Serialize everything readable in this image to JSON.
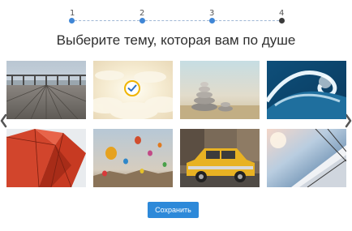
{
  "stepper": {
    "steps": [
      {
        "label": "1",
        "state": "done"
      },
      {
        "label": "2",
        "state": "done"
      },
      {
        "label": "3",
        "state": "done"
      },
      {
        "label": "4",
        "state": "current"
      }
    ]
  },
  "title": "Выберите тему, которая вам по душе",
  "themes": [
    {
      "subject": "wooden pier",
      "selected": false
    },
    {
      "subject": "clouds with sun",
      "selected": true
    },
    {
      "subject": "stacked stones",
      "selected": false
    },
    {
      "subject": "ocean wave",
      "selected": false
    },
    {
      "subject": "red geometric facade",
      "selected": false
    },
    {
      "subject": "hot air balloons",
      "selected": false
    },
    {
      "subject": "yellow retro taxi",
      "selected": false
    },
    {
      "subject": "sailboat at sunset",
      "selected": false
    }
  ],
  "save_button": "Сохранить",
  "icons": {
    "prev": "chevron-left-icon",
    "next": "chevron-right-icon",
    "selected": "checkmark-icon"
  },
  "colors": {
    "accent": "#2d89d9",
    "step_done": "#3f86d6",
    "step_current": "#3a3a3a",
    "check_ring": "#f0b400"
  }
}
